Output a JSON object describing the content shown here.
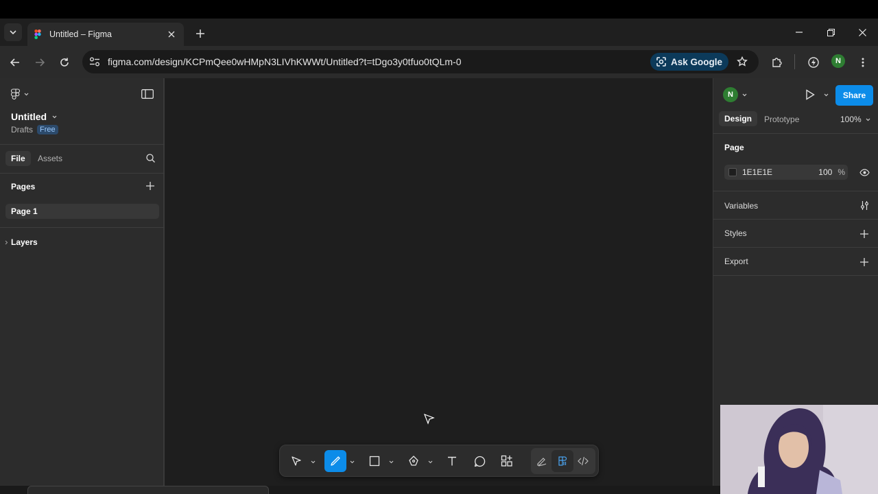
{
  "browser": {
    "tab_title": "Untitled – Figma",
    "url": "figma.com/design/KCPmQee0wHMpN3LIVhKWWt/Untitled?t=tDgo3y0tfuo0tQLm-0",
    "ask_google_label": "Ask Google",
    "profile_initial": "N"
  },
  "left_panel": {
    "file_name": "Untitled",
    "location": "Drafts",
    "plan_badge": "Free",
    "tabs": {
      "file": "File",
      "assets": "Assets"
    },
    "pages_heading": "Pages",
    "pages": [
      "Page 1"
    ],
    "layers_heading": "Layers"
  },
  "right_panel": {
    "avatar_initial": "N",
    "share_label": "Share",
    "tabs": {
      "design": "Design",
      "prototype": "Prototype"
    },
    "zoom": "100%",
    "page_section": "Page",
    "background_color": "1E1E1E",
    "background_opacity": "100",
    "opacity_unit": "%",
    "variables_label": "Variables",
    "styles_label": "Styles",
    "export_label": "Export"
  },
  "toolbar": {
    "tools": [
      "move-tool",
      "pencil-draw-tool",
      "frame-shape-tool",
      "pen-tool",
      "text-tool",
      "comment-tool",
      "actions-tool",
      "draw-mode",
      "design-mode",
      "dev-mode"
    ],
    "active_tool": "pencil-draw-tool"
  },
  "colors": {
    "accent": "#0c8ce9",
    "canvas": "#1e1e1e",
    "panel": "#2c2c2c"
  }
}
